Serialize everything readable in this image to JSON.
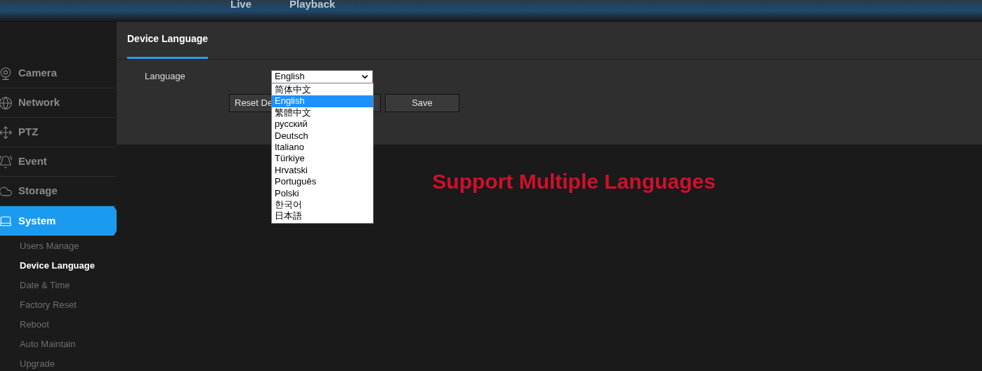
{
  "top_nav": [
    {
      "label": "Live"
    },
    {
      "label": "Playback"
    }
  ],
  "sidebar": {
    "items": [
      {
        "label": "Camera",
        "selected": false
      },
      {
        "label": "Network",
        "selected": false
      },
      {
        "label": "PTZ",
        "selected": false
      },
      {
        "label": "Event",
        "selected": false
      },
      {
        "label": "Storage",
        "selected": false
      },
      {
        "label": "System",
        "selected": true,
        "children": [
          {
            "label": "Users Manage",
            "selected": false
          },
          {
            "label": "Device Language",
            "selected": true
          },
          {
            "label": "Date & Time",
            "selected": false
          },
          {
            "label": "Factory Reset",
            "selected": false
          },
          {
            "label": "Reboot",
            "selected": false
          },
          {
            "label": "Auto Maintain",
            "selected": false
          },
          {
            "label": "Upgrade",
            "selected": false
          }
        ]
      }
    ]
  },
  "tabs": [
    {
      "label": "Device Language",
      "selected": true
    }
  ],
  "form": {
    "language_label": "Language",
    "language_value": "English",
    "language_options": [
      {
        "label": "简体中文",
        "selected": false
      },
      {
        "label": "English",
        "selected": true
      },
      {
        "label": "繁體中文",
        "selected": false
      },
      {
        "label": "русский",
        "selected": false
      },
      {
        "label": "Deutsch",
        "selected": false
      },
      {
        "label": "Italiano",
        "selected": false
      },
      {
        "label": "Türkiye",
        "selected": false
      },
      {
        "label": "Hrvatski",
        "selected": false
      },
      {
        "label": "Português",
        "selected": false
      },
      {
        "label": "Polski",
        "selected": false
      },
      {
        "label": "한국어",
        "selected": false
      },
      {
        "label": "日本語",
        "selected": false
      }
    ],
    "buttons": [
      {
        "label": "Reset De"
      },
      {
        "label": "Save"
      }
    ]
  },
  "banner": "Support Multiple Languages"
}
